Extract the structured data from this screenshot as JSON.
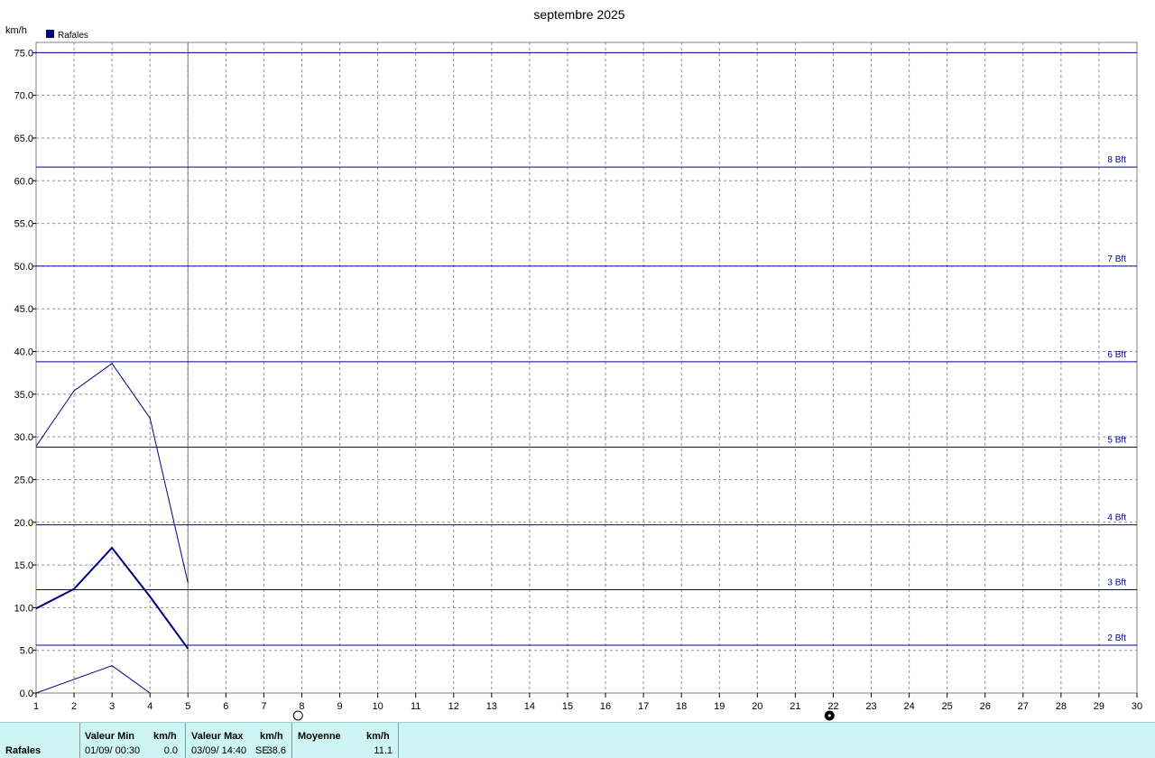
{
  "chart_data": {
    "type": "line",
    "title": "septembre 2025",
    "ylabel": "km/h",
    "ylim": [
      0,
      76.2
    ],
    "y_ticks": [
      "0.0",
      "5.0",
      "10.0",
      "15.0",
      "20.0",
      "25.0",
      "30.0",
      "35.0",
      "40.0",
      "45.0",
      "50.0",
      "55.0",
      "60.0",
      "65.0",
      "70.0",
      "75.0"
    ],
    "x_ticks": [
      1,
      2,
      3,
      4,
      5,
      6,
      7,
      8,
      9,
      10,
      11,
      12,
      13,
      14,
      15,
      16,
      17,
      18,
      19,
      20,
      21,
      22,
      23,
      24,
      25,
      26,
      27,
      28,
      29,
      30
    ],
    "xlim": [
      1,
      30
    ],
    "grid": true,
    "legend": {
      "position": "top-left",
      "entries": [
        {
          "name": "Rafales",
          "color": "#000080"
        }
      ]
    },
    "series": [
      {
        "name": "Rafales",
        "role": "average",
        "x": [
          1,
          2,
          3,
          4,
          5
        ],
        "values": [
          9.9,
          12.2,
          17.0,
          11.3,
          5.2
        ]
      },
      {
        "role": "max",
        "x": [
          1,
          2,
          3,
          4,
          5
        ],
        "values": [
          28.9,
          35.4,
          38.6,
          32.2,
          12.9
        ]
      },
      {
        "role": "min",
        "x": [
          1,
          3,
          4
        ],
        "values": [
          0.0,
          3.2,
          0.0
        ]
      }
    ],
    "beaufort_lines": [
      {
        "label": "2 Bft",
        "value": 5.6
      },
      {
        "label": "3 Bft",
        "value": 12.1
      },
      {
        "label": "4 Bft",
        "value": 19.7
      },
      {
        "label": "5 Bft",
        "value": 28.8
      },
      {
        "label": "6 Bft",
        "value": 38.8
      },
      {
        "label": "7 Bft",
        "value": 50.0
      },
      {
        "label": "8 Bft",
        "value": 61.6
      },
      {
        "label": "",
        "value": 75.0
      }
    ],
    "current_day_marker": 5,
    "moon_phases": [
      {
        "day": 7.9,
        "phase": "full-moon"
      },
      {
        "day": 21.9,
        "phase": "new-moon"
      }
    ],
    "colors": {
      "series": "#000080",
      "beaufort": "#0000a0",
      "grid": "#909090"
    }
  },
  "stats": {
    "row_label": "Rafales",
    "min_header": "Valeur Min",
    "min_unit": "km/h",
    "min_date": "01/09/  00:30",
    "min_value": "0.0",
    "max_header": "Valeur Max",
    "max_unit": "km/h",
    "max_date": "03/09/  14:40",
    "max_dir": "SE",
    "max_value": "38.6",
    "avg_header": "Moyenne",
    "avg_unit": "km/h",
    "avg_value": "11.1"
  }
}
